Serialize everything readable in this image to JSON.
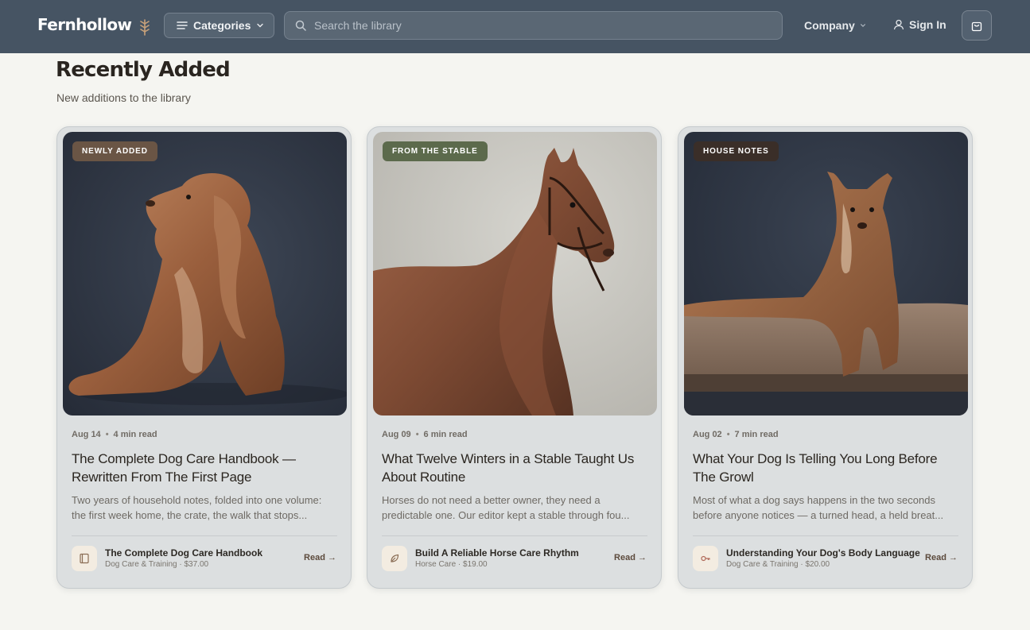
{
  "header": {
    "brand": "Fernhollow",
    "categories_label": "Categories",
    "search_placeholder": "Search the library",
    "company_label": "Company",
    "signin_label": "Sign In"
  },
  "section": {
    "title": "Recently Added",
    "subtitle": "New additions to the library"
  },
  "cards": [
    {
      "tag": "NEWLY ADDED",
      "tag_color": "#6a5545",
      "date": "Aug 14",
      "read_time": "4 min read",
      "title": "The Complete Dog Care Handbook — Rewritten From The First Page",
      "excerpt": "Two years of household notes, folded into one volume: the first week home, the crate, the walk that stops...",
      "product_icon": "book-icon",
      "product_name": "The Complete Dog Care Handbook",
      "product_sub": "Dog Care & Training · $37.00",
      "read_label": "Read →"
    },
    {
      "tag": "FROM THE STABLE",
      "tag_color": "#5c6a4c",
      "date": "Aug 09",
      "read_time": "6 min read",
      "title": "What Twelve Winters in a Stable Taught Us About Routine",
      "excerpt": "Horses do not need a better owner, they need a predictable one. Our editor kept a stable through fou...",
      "product_icon": "leaf-icon",
      "product_name": "Build A Reliable Horse Care Rhythm",
      "product_sub": "Horse Care · $19.00",
      "read_label": "Read →"
    },
    {
      "tag": "HOUSE NOTES",
      "tag_color": "#3a2e28",
      "date": "Aug 02",
      "read_time": "7 min read",
      "title": "What Your Dog Is Telling You Long Before The Growl",
      "excerpt": "Most of what a dog says happens in the two seconds before anyone notices — a turned head, a held breat...",
      "product_icon": "key-icon",
      "product_name": "Understanding Your Dog's Body Language",
      "product_sub": "Dog Care & Training · $20.00",
      "read_label": "Read →"
    }
  ]
}
